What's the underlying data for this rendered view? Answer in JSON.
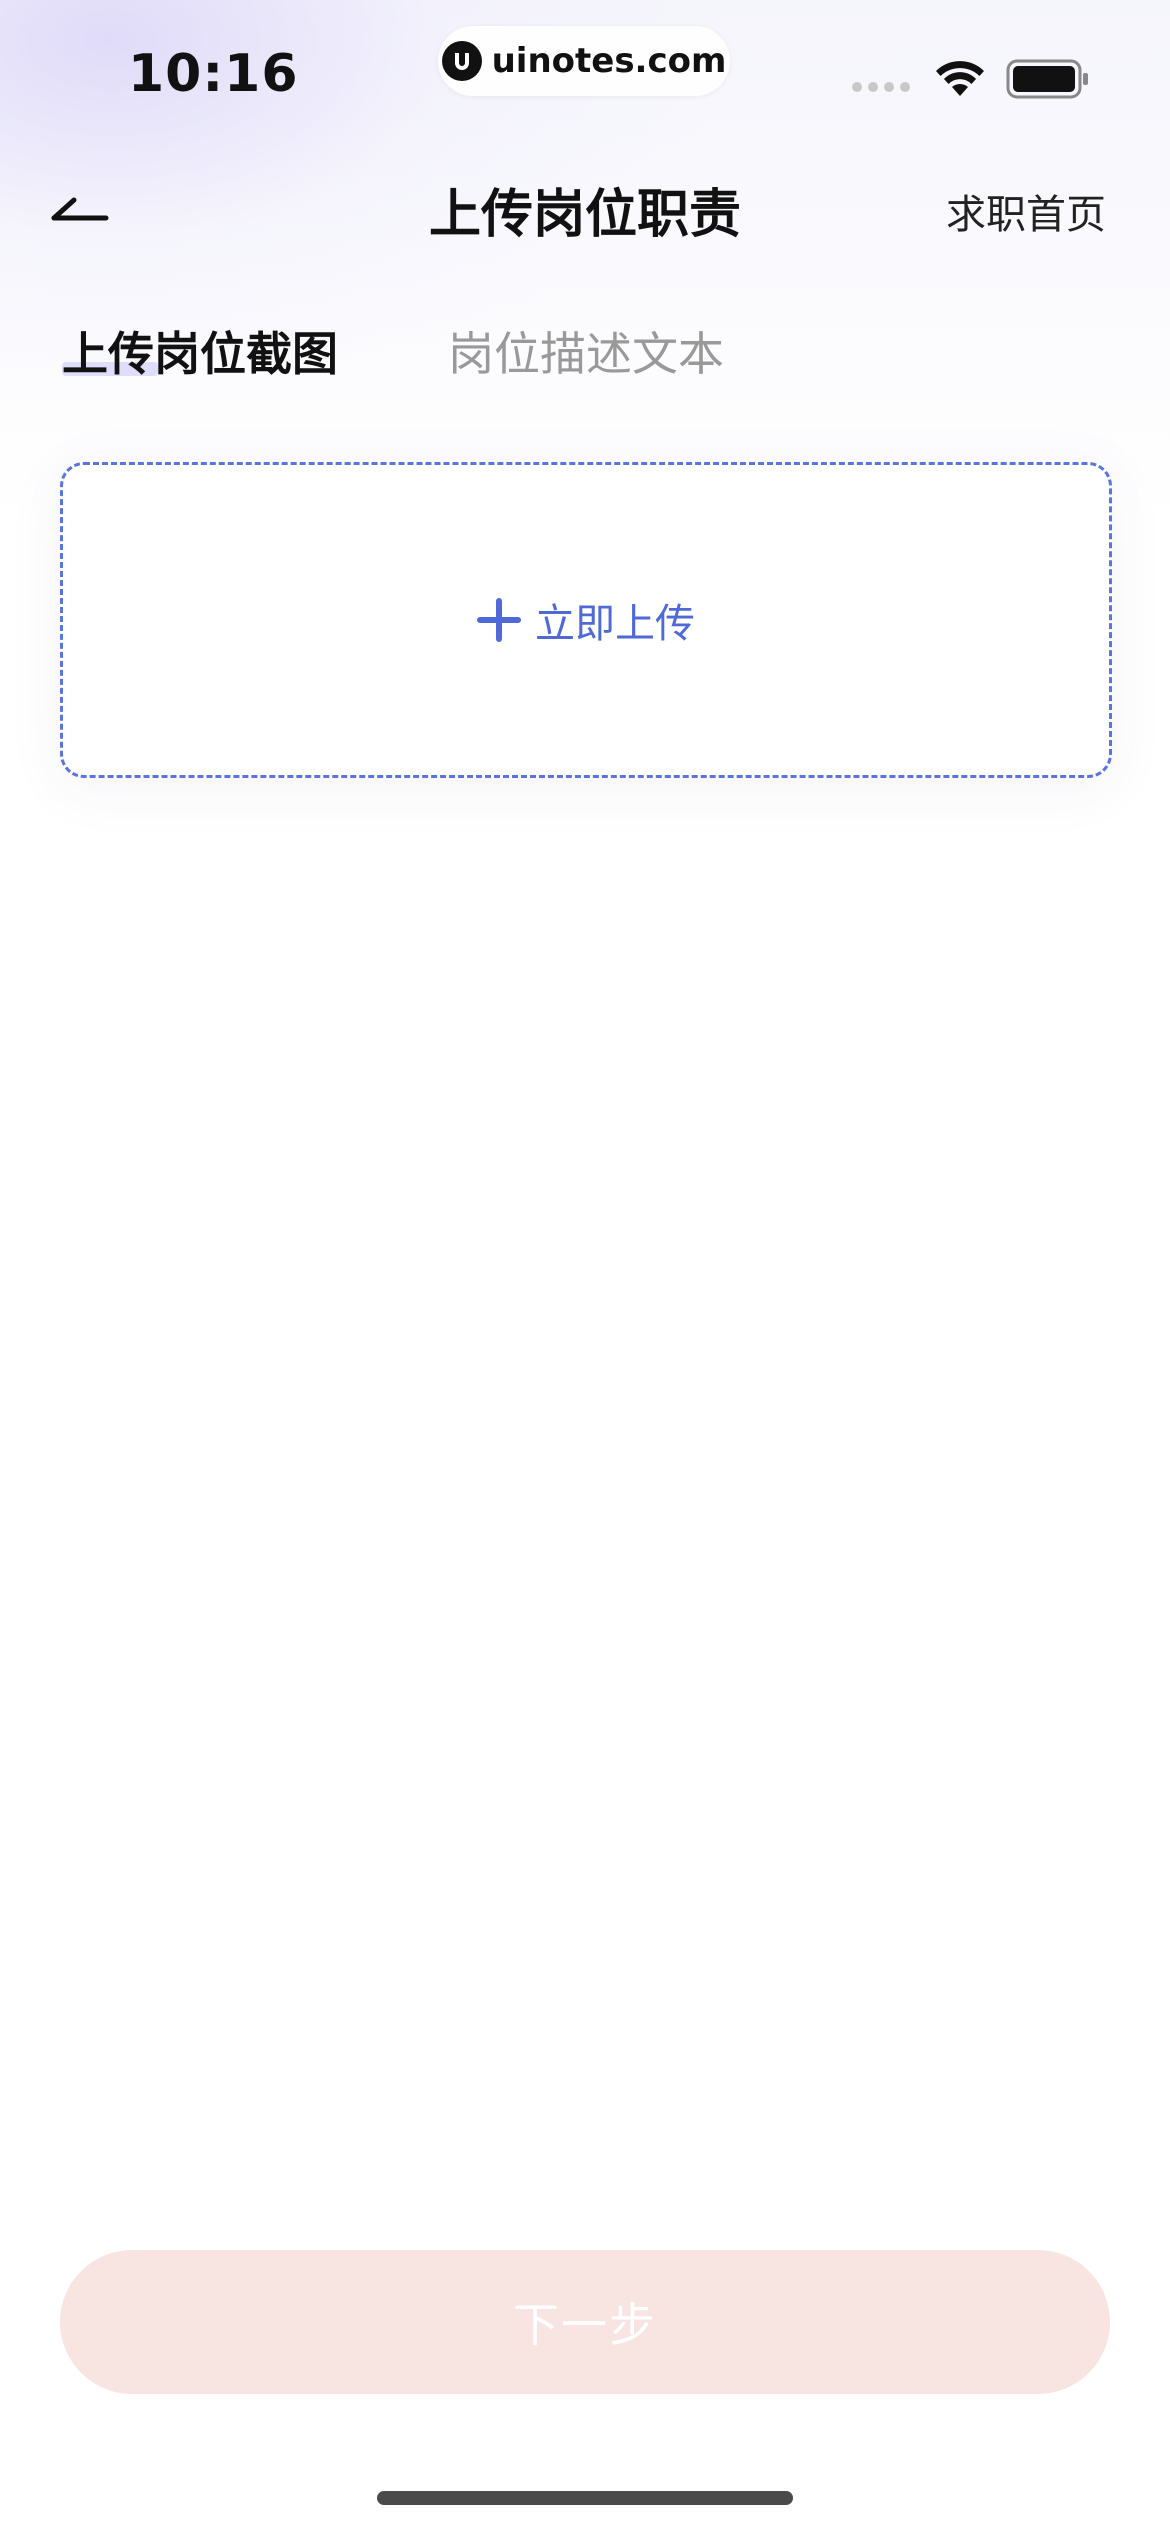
{
  "status_bar": {
    "time": "10:16",
    "url": "uinotes.com",
    "icons": [
      "signal-dots-icon",
      "wifi-icon",
      "battery-icon"
    ]
  },
  "nav": {
    "title": "上传岗位职责",
    "right_link": "求职首页",
    "back_icon": "back-arrow-icon"
  },
  "tabs": [
    {
      "label": "上传岗位截图",
      "active": true
    },
    {
      "label": "岗位描述文本",
      "active": false
    }
  ],
  "upload": {
    "label": "立即上传",
    "icon": "plus-icon"
  },
  "footer": {
    "next_label": "下一步"
  },
  "colors": {
    "accent": "#4f6ad8",
    "next_button_bg": "#f8e4e1",
    "inactive_tab": "#999999"
  }
}
